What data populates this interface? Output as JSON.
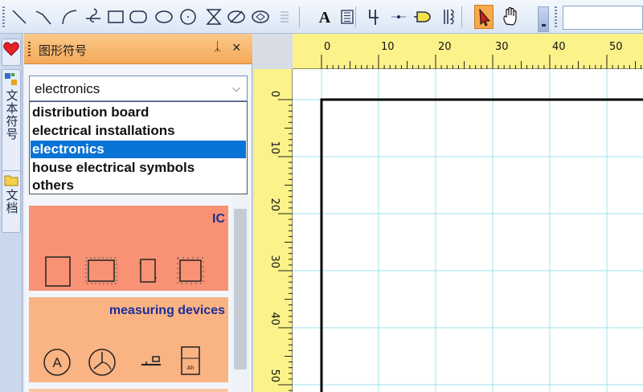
{
  "toolbar": {
    "tools": [
      {
        "name": "line-tool-icon"
      },
      {
        "name": "diagonal-line-tool-icon"
      },
      {
        "name": "arc-tool-icon"
      },
      {
        "name": "curve-tool-icon"
      },
      {
        "name": "rectangle-tool-icon"
      },
      {
        "name": "rounded-rectangle-tool-icon"
      },
      {
        "name": "ellipse-tool-icon"
      },
      {
        "name": "circle-tool-icon"
      },
      {
        "name": "hourglass-shape-tool-icon"
      },
      {
        "name": "slashed-ellipse-tool-icon"
      },
      {
        "name": "crossed-ellipse-tool-icon"
      },
      {
        "name": "align-lines-icon"
      },
      {
        "name": "text-tool-icon",
        "glyph": "A"
      },
      {
        "name": "text-block-tool-icon"
      },
      {
        "name": "connector-tool-icon"
      },
      {
        "name": "junction-tool-icon"
      },
      {
        "name": "gate-symbol-tool-icon"
      },
      {
        "name": "transformer-symbol-tool-icon"
      },
      {
        "name": "select-pointer-icon"
      },
      {
        "name": "pan-hand-icon"
      }
    ],
    "active_tool": "select-pointer-icon",
    "accent_color": "#f7a94c"
  },
  "side_tabs": [
    {
      "name": "favorites-tab",
      "icon": "heart-icon",
      "label": ""
    },
    {
      "name": "text-symbols-tab",
      "icon": "text-symbols-icon",
      "label": "文本符号"
    },
    {
      "name": "documents-tab",
      "icon": "folder-icon",
      "label": "文档"
    }
  ],
  "panel": {
    "title": "图形符号",
    "pin_glyph": "ᛣ",
    "close_glyph": "×",
    "header_color": "#f7b26a",
    "select": {
      "value": "electronics",
      "chevron": "⌵",
      "options": [
        {
          "label": "distribution board",
          "selected": false
        },
        {
          "label": "electrical installations",
          "selected": false
        },
        {
          "label": "electronics",
          "selected": true
        },
        {
          "label": "house electrical symbols",
          "selected": false
        },
        {
          "label": "others",
          "selected": false
        }
      ]
    },
    "groups": [
      {
        "label": "IC",
        "color": "#f99274",
        "icons": [
          "ic-tall-rect-icon",
          "ic-dotted-rect-icon",
          "ic-narrow-rect-icon",
          "ic-square-icon"
        ]
      },
      {
        "label": "measuring devices",
        "color": "#fab383",
        "icons": [
          "ammeter-icon",
          "meter-clock-icon",
          "switch-symbol-icon",
          "meter-box-icon"
        ],
        "icon_texts": [
          "A",
          "",
          "",
          "Ah"
        ]
      }
    ]
  },
  "rulers": {
    "horizontal": [
      "0",
      "10",
      "20",
      "30",
      "40",
      "50"
    ],
    "vertical": [
      "0",
      "10",
      "20",
      "30",
      "40",
      "50"
    ],
    "color": "#fcf28a"
  },
  "canvas": {
    "grid_color": "#9ee3ea"
  }
}
